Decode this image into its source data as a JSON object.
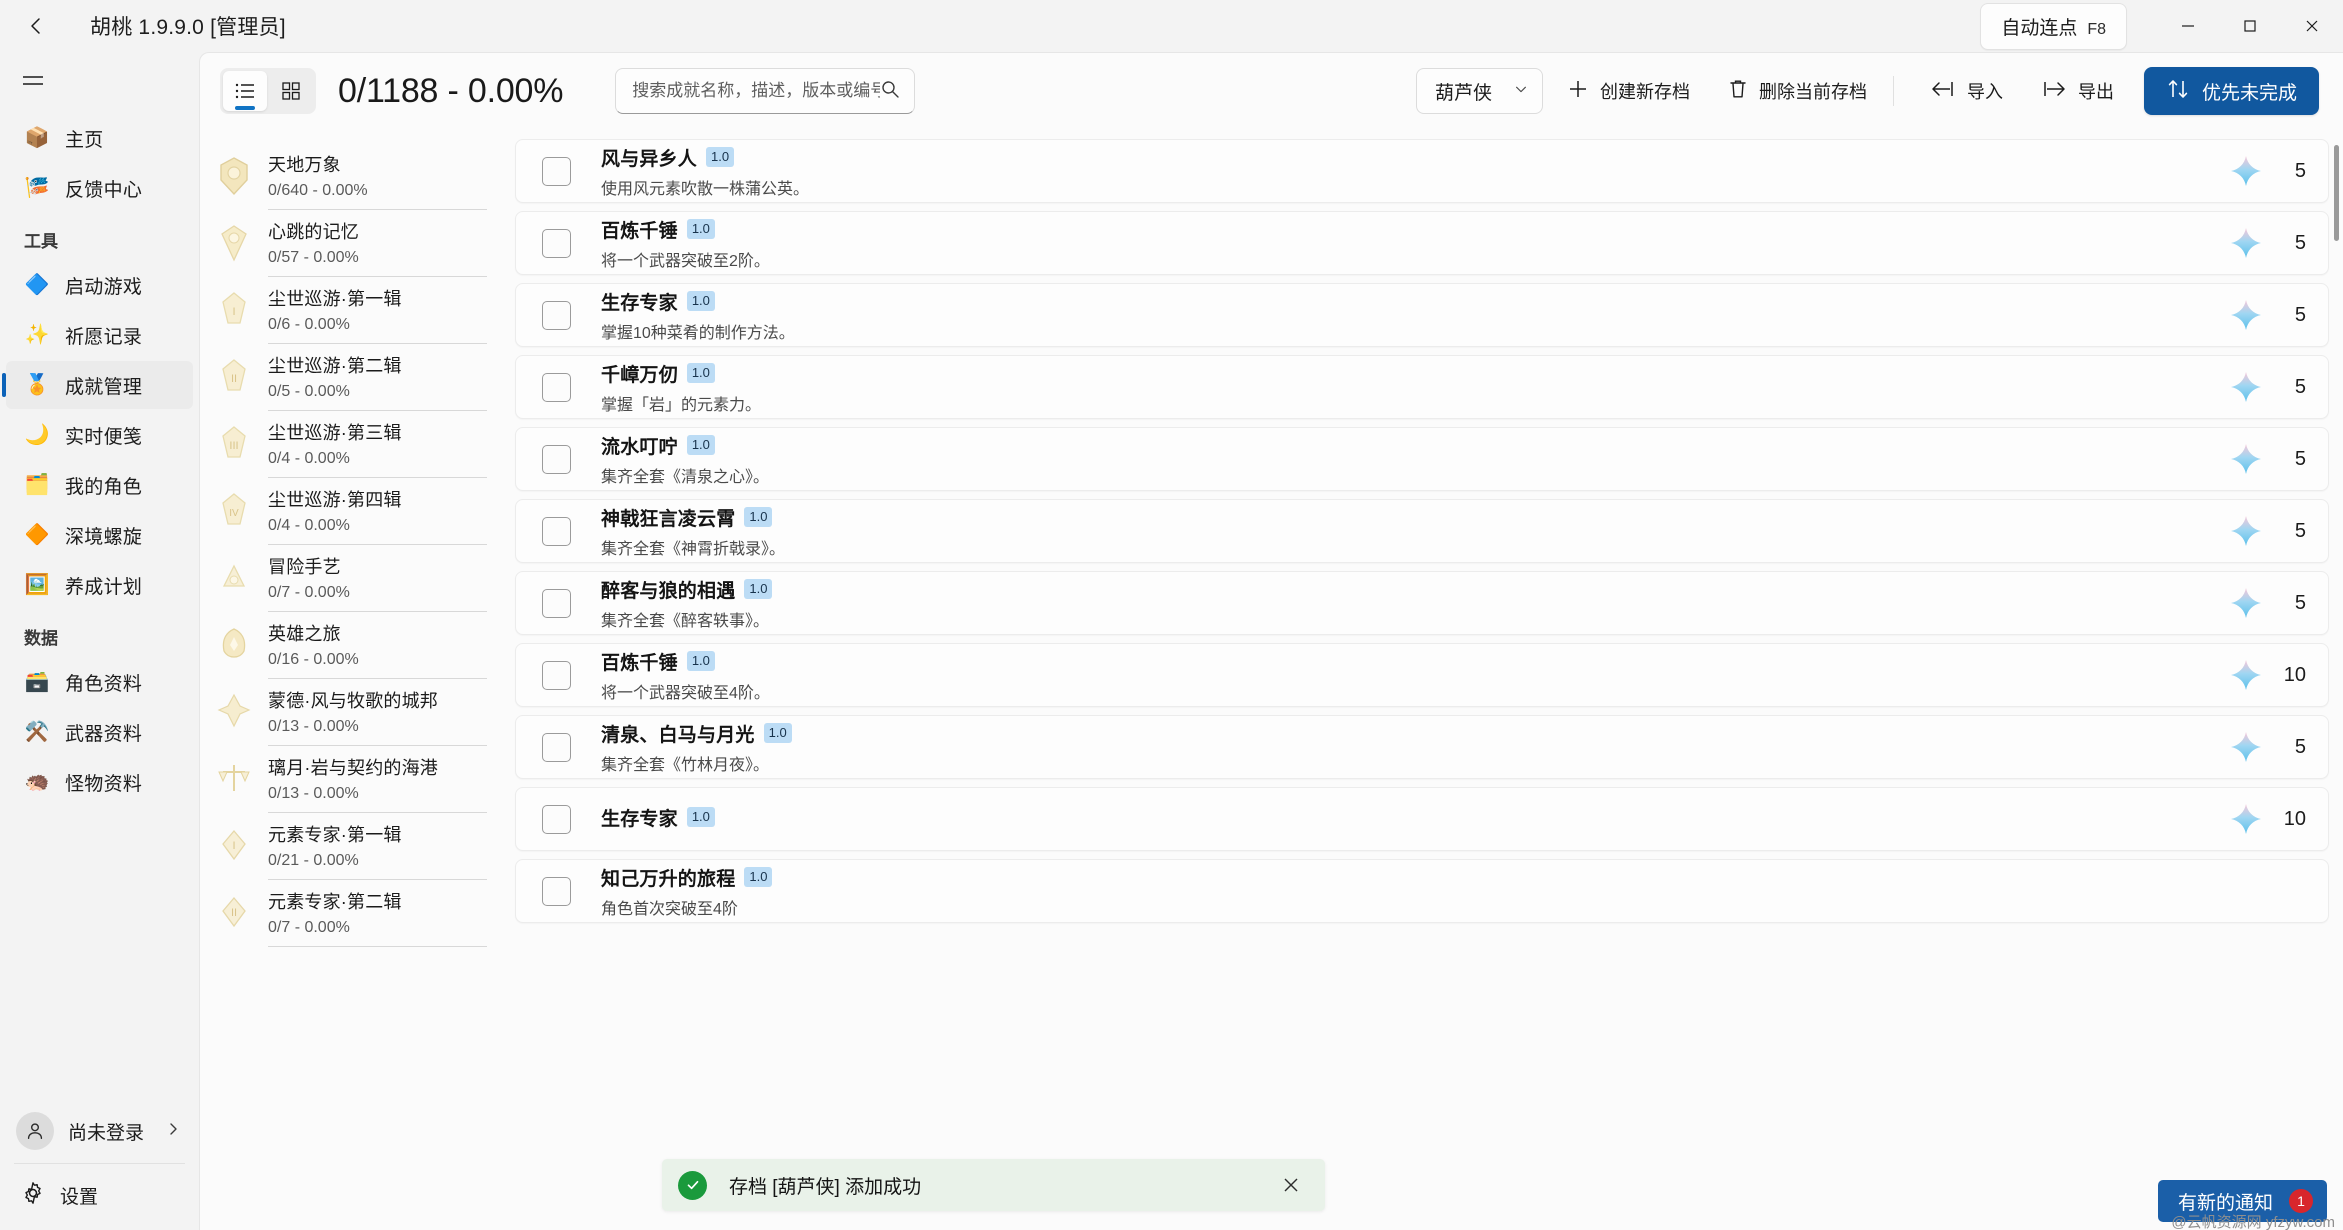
{
  "titlebar": {
    "back_icon": "arrow-left-icon",
    "title": "胡桃 1.9.9.0 [管理员]",
    "autoclick_label": "自动连点",
    "autoclick_key": "F8",
    "minimize_label": "最小化",
    "maximize_label": "最大化",
    "close_label": "关闭"
  },
  "sidebar": {
    "menu_icon": "hamburger-icon",
    "top_items": [
      {
        "label": "主页",
        "icon": "home-box-icon"
      },
      {
        "label": "反馈中心",
        "icon": "feedback-banner-icon"
      }
    ],
    "groups": [
      {
        "label": "工具",
        "items": [
          {
            "label": "启动游戏",
            "icon": "launch-gem-icon"
          },
          {
            "label": "祈愿记录",
            "icon": "wish-star-icon"
          },
          {
            "label": "成就管理",
            "icon": "achievement-crest-icon",
            "active": true
          },
          {
            "label": "实时便笺",
            "icon": "resin-moon-icon"
          },
          {
            "label": "我的角色",
            "icon": "my-character-card-icon"
          },
          {
            "label": "深境螺旋",
            "icon": "abyss-diamond-icon"
          },
          {
            "label": "养成计划",
            "icon": "cultivation-plan-icon"
          }
        ]
      },
      {
        "label": "数据",
        "items": [
          {
            "label": "角色资料",
            "icon": "character-data-icon"
          },
          {
            "label": "武器资料",
            "icon": "weapon-data-icon"
          },
          {
            "label": "怪物资料",
            "icon": "monster-data-icon"
          }
        ]
      }
    ],
    "account": {
      "label": "尚未登录",
      "icon": "person-icon",
      "chevron": "chevron-right-icon"
    },
    "settings": {
      "label": "设置",
      "icon": "gear-icon"
    }
  },
  "toolbar": {
    "view_list_icon": "list-view-icon",
    "view_grid_icon": "grid-view-icon",
    "progress": "0/1188 - 0.00%",
    "search_placeholder": "搜索成就名称，描述，版本或编号",
    "search_value": "",
    "search_icon": "search-icon",
    "save_selected": "葫芦侠",
    "save_chevron": "chevron-down-icon",
    "create_save": {
      "label": "创建新存档",
      "icon": "plus-icon"
    },
    "delete_save": {
      "label": "删除当前存档",
      "icon": "trash-icon"
    },
    "import": {
      "label": "导入",
      "icon": "import-arrow-icon"
    },
    "export": {
      "label": "导出",
      "icon": "export-arrow-icon"
    },
    "primary": {
      "label": "优先未完成",
      "icon": "sort-updown-icon",
      "color": "#11589f"
    }
  },
  "categories": [
    {
      "name": "天地万象",
      "progress": "0/640 - 0.00%",
      "icon": "crest-gold-icon"
    },
    {
      "name": "心跳的记忆",
      "progress": "0/57 - 0.00%",
      "icon": "crest-heart-icon"
    },
    {
      "name": "尘世巡游·第一辑",
      "progress": "0/6 - 0.00%",
      "icon": "crest-travel1-icon"
    },
    {
      "name": "尘世巡游·第二辑",
      "progress": "0/5 - 0.00%",
      "icon": "crest-travel2-icon"
    },
    {
      "name": "尘世巡游·第三辑",
      "progress": "0/4 - 0.00%",
      "icon": "crest-travel3-icon"
    },
    {
      "name": "尘世巡游·第四辑",
      "progress": "0/4 - 0.00%",
      "icon": "crest-travel4-icon"
    },
    {
      "name": "冒险手艺",
      "progress": "0/7 - 0.00%",
      "icon": "crest-craft-icon"
    },
    {
      "name": "英雄之旅",
      "progress": "0/16 - 0.00%",
      "icon": "crest-hero-icon"
    },
    {
      "name": "蒙德·风与牧歌的城邦",
      "progress": "0/13 - 0.00%",
      "icon": "crest-mondstadt-icon"
    },
    {
      "name": "璃月·岩与契约的海港",
      "progress": "0/13 - 0.00%",
      "icon": "crest-liyue-icon"
    },
    {
      "name": "元素专家·第一辑",
      "progress": "0/21 - 0.00%",
      "icon": "crest-element1-icon"
    },
    {
      "name": "元素专家·第二辑",
      "progress": "0/7 - 0.00%",
      "icon": "crest-element2-icon"
    }
  ],
  "achievements": [
    {
      "title": "风与异乡人",
      "version": "1.0",
      "desc": "使用风元素吹散一株蒲公英。",
      "reward": "5"
    },
    {
      "title": "百炼千锤",
      "version": "1.0",
      "desc": "将一个武器突破至2阶。",
      "reward": "5"
    },
    {
      "title": "生存专家",
      "version": "1.0",
      "desc": "掌握10种菜肴的制作方法。",
      "reward": "5"
    },
    {
      "title": "千嶂万仞",
      "version": "1.0",
      "desc": "掌握「岩」的元素力。",
      "reward": "5"
    },
    {
      "title": "流水叮咛",
      "version": "1.0",
      "desc": "集齐全套《清泉之心》。",
      "reward": "5"
    },
    {
      "title": "神戟狂言凌云霄",
      "version": "1.0",
      "desc": "集齐全套《神霄折戟录》。",
      "reward": "5"
    },
    {
      "title": "醉客与狼的相遇",
      "version": "1.0",
      "desc": "集齐全套《醉客轶事》。",
      "reward": "5"
    },
    {
      "title": "百炼千锤",
      "version": "1.0",
      "desc": "将一个武器突破至4阶。",
      "reward": "10"
    },
    {
      "title": "清泉、白马与月光",
      "version": "1.0",
      "desc": "集齐全套《竹林月夜》。",
      "reward": "5"
    },
    {
      "title": "生存专家",
      "version": "1.0",
      "desc": "",
      "reward": "10"
    },
    {
      "title": "知己万升的旅程",
      "version": "1.0",
      "desc": "角色首次突破至4阶",
      "reward": ""
    }
  ],
  "toast": {
    "icon": "check-circle-icon",
    "message": "存档 [葫芦侠] 添加成功",
    "close_icon": "close-icon",
    "color": "#1a9a3c"
  },
  "notification": {
    "label": "有新的通知",
    "count": "1",
    "color": "#1b5fa8"
  },
  "watermark": "@云帆资源网 yfzyw.com"
}
